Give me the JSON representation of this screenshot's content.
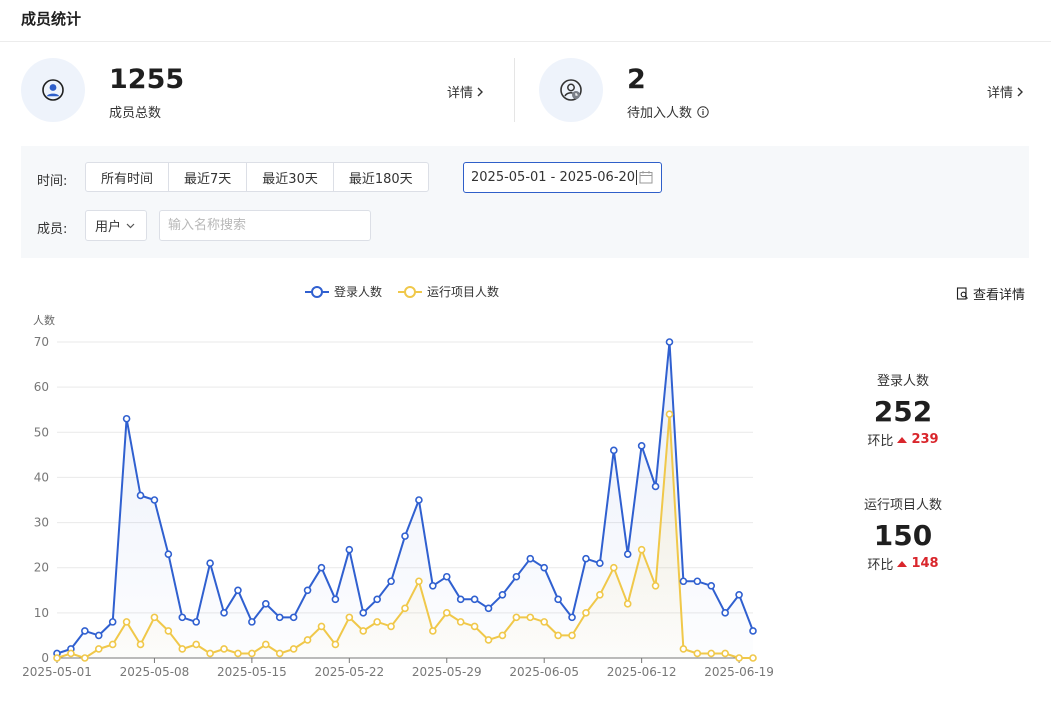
{
  "page_title": "成员统计",
  "stats": [
    {
      "number": "1255",
      "label": "成员总数",
      "detail": "详情"
    },
    {
      "number": "2",
      "label": "待加入人数",
      "detail": "详情"
    }
  ],
  "filters": {
    "time_label": "时间:",
    "time_options": [
      "所有时间",
      "最近7天",
      "最近30天",
      "最近180天"
    ],
    "date_range": "2025-05-01 - 2025-06-20",
    "member_label": "成员:",
    "member_select": "用户",
    "search_placeholder": "输入名称搜索"
  },
  "view_detail": "查看详情",
  "summary": [
    {
      "label": "登录人数",
      "value": "252",
      "change_label": "环比",
      "change": "239"
    },
    {
      "label": "运行项目人数",
      "value": "150",
      "change_label": "环比",
      "change": "148"
    }
  ],
  "colors": {
    "login": "#3060d0",
    "run": "#f0c84a",
    "up": "#d9262c",
    "accent": "#2f5fc9"
  },
  "chart_data": {
    "type": "line",
    "ylabel": "人数",
    "ylim": [
      0,
      70
    ],
    "yticks": [
      0,
      10,
      20,
      30,
      40,
      50,
      60,
      70
    ],
    "x": [
      "2025-05-01",
      "2025-05-02",
      "2025-05-03",
      "2025-05-04",
      "2025-05-05",
      "2025-05-06",
      "2025-05-07",
      "2025-05-08",
      "2025-05-09",
      "2025-05-10",
      "2025-05-11",
      "2025-05-12",
      "2025-05-13",
      "2025-05-14",
      "2025-05-15",
      "2025-05-16",
      "2025-05-17",
      "2025-05-18",
      "2025-05-19",
      "2025-05-20",
      "2025-05-21",
      "2025-05-22",
      "2025-05-23",
      "2025-05-24",
      "2025-05-25",
      "2025-05-26",
      "2025-05-27",
      "2025-05-28",
      "2025-05-29",
      "2025-05-30",
      "2025-05-31",
      "2025-06-01",
      "2025-06-02",
      "2025-06-03",
      "2025-06-04",
      "2025-06-05",
      "2025-06-06",
      "2025-06-07",
      "2025-06-08",
      "2025-06-09",
      "2025-06-10",
      "2025-06-11",
      "2025-06-12",
      "2025-06-13",
      "2025-06-14",
      "2025-06-15",
      "2025-06-16",
      "2025-06-17",
      "2025-06-18",
      "2025-06-19",
      "2025-06-20"
    ],
    "xtick_labels": [
      "2025-05-01",
      "2025-05-08",
      "2025-05-15",
      "2025-05-22",
      "2025-05-29",
      "2025-06-05",
      "2025-06-12",
      "2025-06-19"
    ],
    "legend_placement": "top-center",
    "series": [
      {
        "name": "登录人数",
        "color": "#3060d0",
        "values": [
          1,
          2,
          6,
          5,
          8,
          53,
          36,
          35,
          23,
          9,
          8,
          21,
          10,
          15,
          8,
          12,
          9,
          9,
          15,
          20,
          13,
          24,
          10,
          13,
          17,
          27,
          35,
          16,
          18,
          13,
          13,
          11,
          14,
          18,
          22,
          20,
          13,
          9,
          22,
          21,
          46,
          23,
          47,
          38,
          70,
          17,
          17,
          16,
          10,
          14,
          6
        ]
      },
      {
        "name": "运行项目人数",
        "color": "#f0c84a",
        "values": [
          0,
          1,
          0,
          2,
          3,
          8,
          3,
          9,
          6,
          2,
          3,
          1,
          2,
          1,
          1,
          3,
          1,
          2,
          4,
          7,
          3,
          9,
          6,
          8,
          7,
          11,
          17,
          6,
          10,
          8,
          7,
          4,
          5,
          9,
          9,
          8,
          5,
          5,
          10,
          14,
          20,
          12,
          24,
          16,
          54,
          2,
          1,
          1,
          1,
          0,
          0
        ]
      }
    ]
  }
}
